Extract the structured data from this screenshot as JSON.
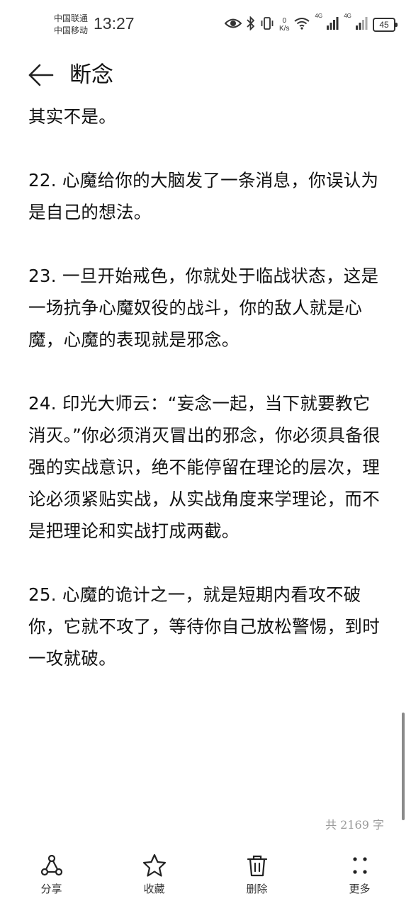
{
  "status": {
    "carrier1": "中国联通",
    "carrier2": "中国移动",
    "time": "13:27",
    "net_speed_value": "0",
    "net_speed_unit": "K/s",
    "signal1_label": "4G",
    "signal2_label": "4G",
    "battery": "45",
    "icons": [
      "eye-icon",
      "bluetooth-icon",
      "vibrate-icon",
      "wifi-icon",
      "signal-icon",
      "battery-icon"
    ]
  },
  "header": {
    "title": "断念",
    "back_icon": "back-arrow-icon"
  },
  "content": {
    "paragraphs": [
      "其实不是。",
      "22. 心魔给你的大脑发了一条消息，你误认为是自己的想法。",
      "23. 一旦开始戒色，你就处于临战状态，这是一场抗争心魔奴役的战斗，你的敌人就是心魔，心魔的表现就是邪念。",
      "24. 印光大师云：“妄念一起，当下就要教它消灭。”你必须消灭冒出的邪念，你必须具备很强的实战意识，绝不能停留在理论的层次，理论必须紧贴实战，从实战角度来学理论，而不是把理论和实战打成两截。",
      "25. 心魔的诡计之一，就是短期内看攻不破你，它就不攻了，等待你自己放松警惕，到时一攻就破。"
    ]
  },
  "word_count": "共 2169 字",
  "toolbar": {
    "share_label": "分享",
    "favorite_label": "收藏",
    "delete_label": "删除",
    "more_label": "更多"
  }
}
